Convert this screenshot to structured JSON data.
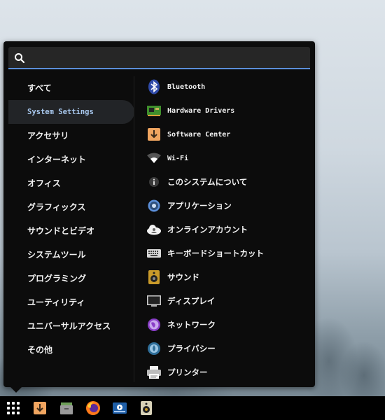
{
  "search": {
    "placeholder": "",
    "value": ""
  },
  "categories": [
    {
      "label": "すべて"
    },
    {
      "label": "System Settings",
      "selected": true
    },
    {
      "label": "アクセサリ"
    },
    {
      "label": "インターネット"
    },
    {
      "label": "オフィス"
    },
    {
      "label": "グラフィックス"
    },
    {
      "label": "サウンドとビデオ"
    },
    {
      "label": "システムツール"
    },
    {
      "label": "プログラミング"
    },
    {
      "label": "ユーティリティ"
    },
    {
      "label": "ユニバーサルアクセス"
    },
    {
      "label": "その他"
    }
  ],
  "apps": [
    {
      "label": "Bluetooth",
      "icon": "bluetooth-icon"
    },
    {
      "label": "Hardware Drivers",
      "icon": "hardware-drivers-icon"
    },
    {
      "label": "Software Center",
      "icon": "software-center-icon"
    },
    {
      "label": "Wi-Fi",
      "icon": "wifi-icon"
    },
    {
      "label": "このシステムについて",
      "icon": "info-icon"
    },
    {
      "label": "アプリケーション",
      "icon": "applications-gear-icon"
    },
    {
      "label": "オンラインアカウント",
      "icon": "online-accounts-icon"
    },
    {
      "label": "キーボードショートカット",
      "icon": "keyboard-icon"
    },
    {
      "label": "サウンド",
      "icon": "speaker-icon"
    },
    {
      "label": "ディスプレイ",
      "icon": "display-icon"
    },
    {
      "label": "ネットワーク",
      "icon": "network-globe-icon"
    },
    {
      "label": "プライバシー",
      "icon": "privacy-icon"
    },
    {
      "label": "プリンター",
      "icon": "printer-icon"
    }
  ],
  "taskbar": [
    {
      "icon": "app-grid-icon"
    },
    {
      "icon": "software-center-icon"
    },
    {
      "icon": "file-manager-icon"
    },
    {
      "icon": "firefox-icon"
    },
    {
      "icon": "media-player-icon"
    },
    {
      "icon": "speaker-icon"
    }
  ],
  "colors": {
    "accent": "#5b8ed8",
    "panel": "#0c0c0c",
    "selected_bg": "#222427"
  }
}
